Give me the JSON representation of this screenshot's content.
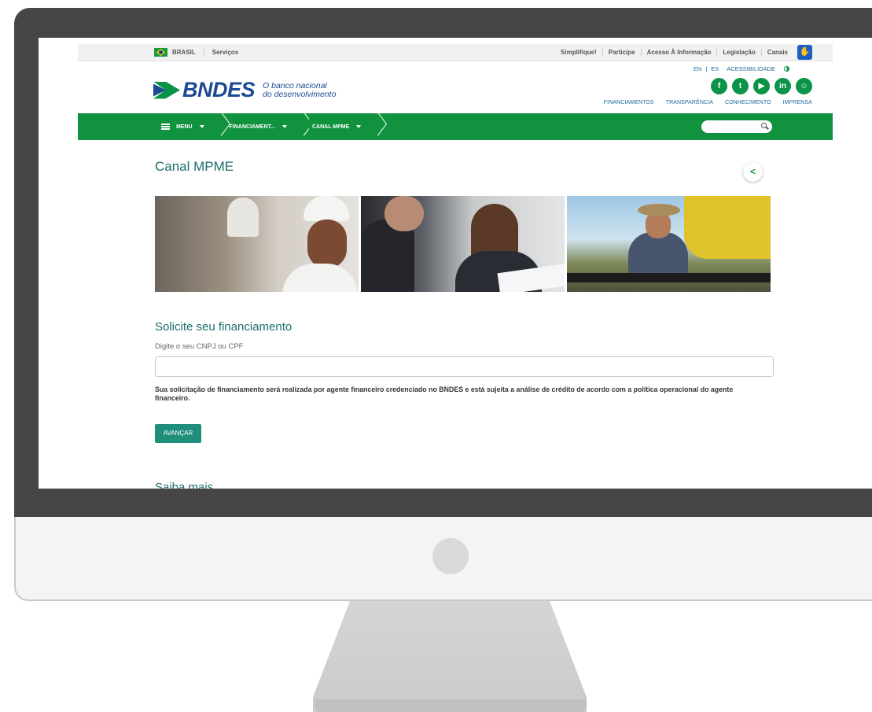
{
  "gov_bar": {
    "country": "BRASIL",
    "services": "Serviços",
    "links": [
      "Simplifique!",
      "Participe",
      "Acesso À Informação",
      "Legislação",
      "Canais"
    ]
  },
  "header": {
    "logo_text": "BNDES",
    "tagline_line1": "O banco nacional",
    "tagline_line2": "do desenvolvimento",
    "lang_en": "EN",
    "lang_sep": "|",
    "lang_es": "ES",
    "accessibility": "ACESSIBILIDADE",
    "social": [
      "f",
      "t",
      "▶",
      "in",
      "☺"
    ],
    "links": [
      "FINANCIAMENTOS",
      "TRANSPARÊNCIA",
      "CONHECIMENTO",
      "IMPRENSA"
    ]
  },
  "nav": {
    "menu": "MENU",
    "crumb1": "FINANCIAMENT...",
    "crumb2": "CANAL MPME",
    "search_placeholder": ""
  },
  "page": {
    "title": "Canal MPME",
    "share_glyph": "<",
    "section_title": "Solicite seu financiamento",
    "field_label": "Digite o seu CNPJ ou CPF",
    "input_value": "",
    "disclaimer": "Sua solicitação de financiamento será realizada por agente financeiro credenciado no BNDES e está sujeita a análise de crédito de acordo com a política operacional do agente financeiro.",
    "advance_button": "AVANÇAR",
    "next_section": "Saiba mais"
  },
  "colors": {
    "brand_green": "#11923f",
    "brand_blue": "#1c4a94",
    "title_teal": "#1b6e6a",
    "button_teal": "#1f8f7c"
  }
}
